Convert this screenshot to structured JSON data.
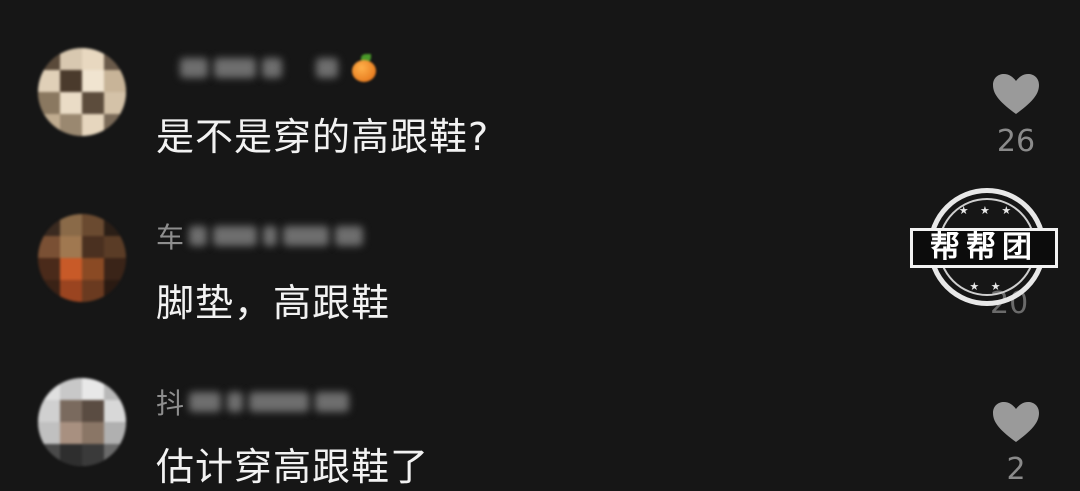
{
  "comments": [
    {
      "name": "",
      "text": "是不是穿的高跟鞋?",
      "likes": "26",
      "avatar_icon": "avatar-blurred"
    },
    {
      "name": "车",
      "text": "脚垫，高跟鞋",
      "likes": "20",
      "avatar_icon": "avatar-blurred"
    },
    {
      "name": "抖",
      "text": "估计穿高跟鞋了",
      "likes": "2",
      "avatar_icon": "avatar-blurred"
    }
  ],
  "watermark": {
    "text": "帮帮团",
    "stars_top": "★ ★ ★",
    "stars_bottom": "★ ★"
  },
  "colors": {
    "background": "#161616",
    "comment_text": "#f2f2f2",
    "username": "#8e8e8e",
    "heart": "#9a9a9a"
  }
}
